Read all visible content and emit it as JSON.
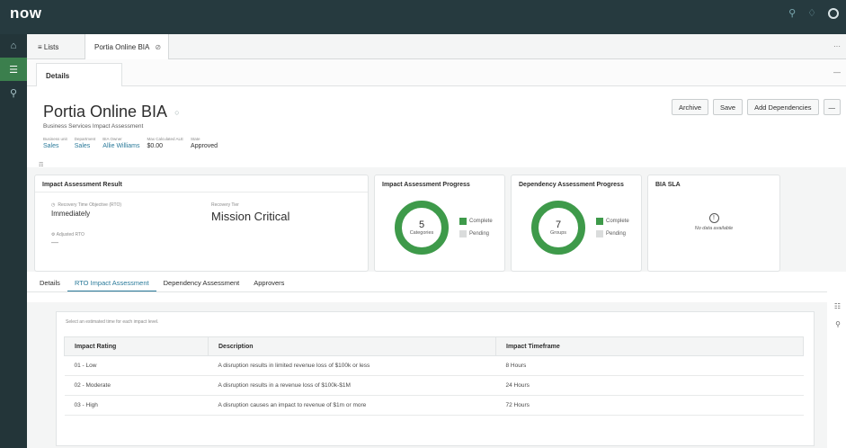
{
  "app": {
    "logo": "now"
  },
  "topbar": {
    "icons": [
      "search-icon",
      "bell-icon",
      "user-avatar"
    ]
  },
  "leftnav": {
    "items": [
      "home-icon",
      "list-icon",
      "pin-icon"
    ]
  },
  "tabs": {
    "lists_label": "≡ Lists",
    "record_tab": "Portia Online BIA",
    "more": "···"
  },
  "subtab": {
    "label": "Details",
    "more": "—"
  },
  "record": {
    "title": "Portia Online BIA",
    "subtitle": "Business Services Impact Assessment",
    "meta": [
      {
        "key": "Business unit",
        "value": "Sales"
      },
      {
        "key": "Department",
        "value": "Sales"
      },
      {
        "key": "BIA Owner",
        "value": "Allie Williams"
      },
      {
        "key": "Max Calculated ALE",
        "value": "$0.00"
      },
      {
        "key": "State",
        "value": "Approved"
      }
    ]
  },
  "actions": {
    "archive": "Archive",
    "save": "Save",
    "add_dependencies": "Add Dependencies",
    "more": "—"
  },
  "impact_result": {
    "title": "Impact Assessment Result",
    "rto_label": "Recovery Time Objective (RTO)",
    "rto_value": "Immediately",
    "adj_label": "Adjusted RTO",
    "adj_value": "—",
    "tier_label": "Recovery Tier",
    "tier_value": "Mission Critical"
  },
  "impact_progress": {
    "title": "Impact Assessment Progress",
    "count": "5",
    "unit": "Categories",
    "complete": "Complete",
    "pending": "Pending",
    "complete_fraction": 1.0
  },
  "dependency_progress": {
    "title": "Dependency Assessment Progress",
    "count": "7",
    "unit": "Groups",
    "complete": "Complete",
    "pending": "Pending",
    "complete_fraction": 1.0
  },
  "bia_sla": {
    "title": "BIA SLA",
    "empty": "No data available"
  },
  "form_tabs": [
    "Details",
    "RTO Impact Assessment",
    "Dependency Assessment",
    "Approvers"
  ],
  "rto_table": {
    "hint": "Select an estimated time for each impact level.",
    "headers": [
      "Impact Rating",
      "Description",
      "Impact Timeframe"
    ],
    "rows": [
      [
        "01 - Low",
        "A disruption results in limited revenue loss of $100k or less",
        "8 Hours"
      ],
      [
        "02 - Moderate",
        "A disruption results in a revenue loss of $100k-$1M",
        "24 Hours"
      ],
      [
        "03 - High",
        "A disruption causes an impact to revenue of $1m or more",
        "72 Hours"
      ]
    ]
  }
}
